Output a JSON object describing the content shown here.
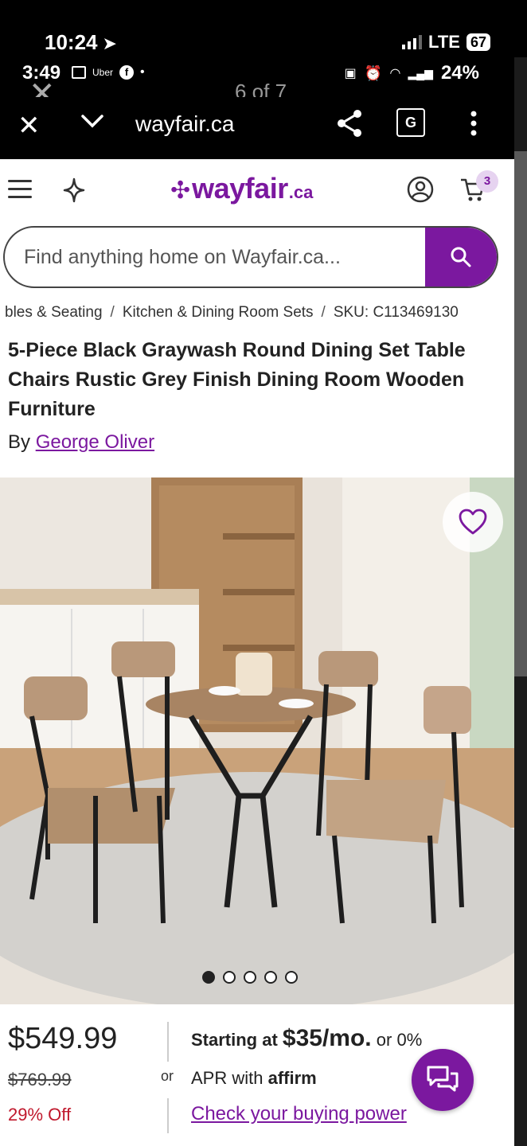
{
  "outer_status": {
    "time": "10:24",
    "network": "LTE",
    "battery": "67"
  },
  "inner_status": {
    "time": "3:49",
    "app_label": "Uber",
    "battery": "24%"
  },
  "viewer": {
    "counter": "6 of 7"
  },
  "browser": {
    "url": "wayfair.ca"
  },
  "header": {
    "logo_word": "wayfair",
    "logo_tld": ".ca",
    "cart_count": "3",
    "brand_color": "#7b189f"
  },
  "search": {
    "placeholder": "Find anything home on Wayfair.ca..."
  },
  "breadcrumb": {
    "items": [
      "bles & Seating",
      "Kitchen & Dining Room Sets",
      "SKU: C113469130"
    ],
    "separator": "/"
  },
  "product": {
    "title": "5-Piece Black Graywash Round Dining Set Table Chairs Rustic Grey Finish Dining Room Wooden Furniture",
    "by_label": "By",
    "brand": "George Oliver"
  },
  "carousel": {
    "total": 5,
    "active": 1
  },
  "pricing": {
    "price": "$549.99",
    "original_price": "$769.99",
    "discount": "29% Off",
    "or_label": "or",
    "financing_prefix": "Starting at",
    "financing_amount": "$35/mo.",
    "financing_suffix": "or 0%",
    "financing_line2": "APR with",
    "affirm": "affirm",
    "check_link": "Check your buying power"
  }
}
